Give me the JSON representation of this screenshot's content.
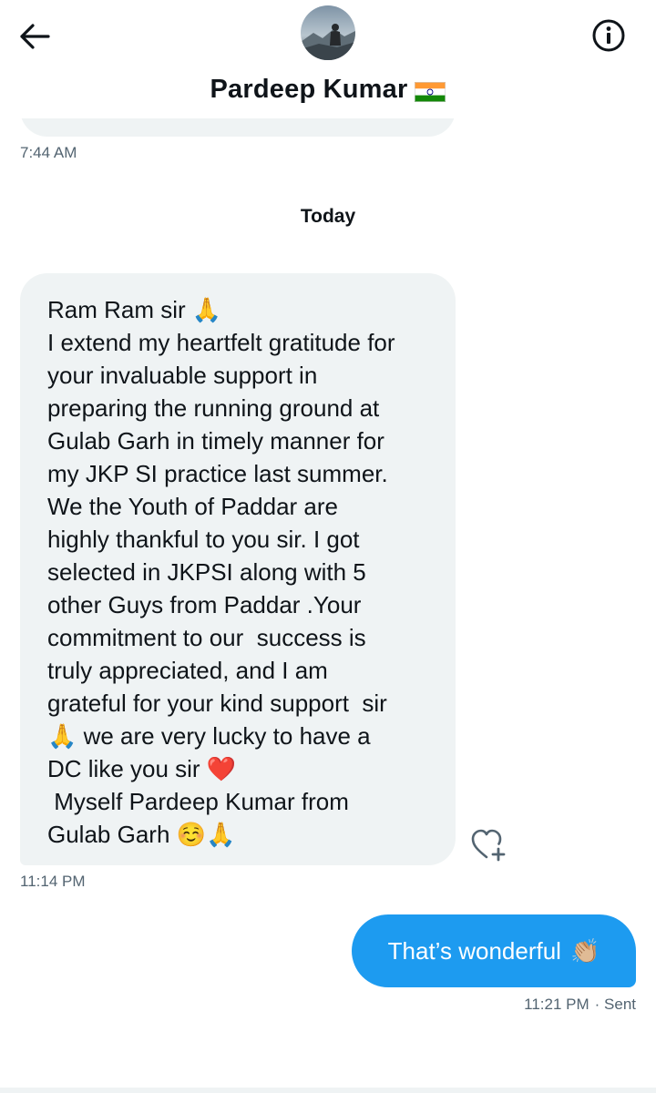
{
  "header": {
    "contact_name": "Pardeep Kumar",
    "flag_icon": "india-flag-icon",
    "back_icon": "arrow-left-icon",
    "info_icon": "info-icon"
  },
  "conversation": {
    "previous_timestamp": "7:44 AM",
    "day_divider": "Today",
    "received": {
      "text": "Ram Ram sir 🙏\nI extend my heartfelt gratitude for\nyour invaluable support in\npreparing the running ground at\nGulab Garh in timely manner for\nmy JKP SI practice last summer.\nWe the Youth of Paddar are\nhighly thankful to you sir. I got\nselected in JKPSI along with 5\nother Guys from Paddar .Your\ncommitment to our  success is\ntruly appreciated, and I am\ngrateful for your kind support  sir\n🙏 we are very lucky to have a\nDC like you sir ❤️\n Myself Pardeep Kumar from\nGulab Garh ☺️🙏",
      "timestamp": "11:14 PM",
      "react_icon": "heart-add-icon"
    },
    "sent": {
      "text": "That’s wonderful",
      "emoji": "👏🏼",
      "timestamp": "11:21 PM",
      "status": "· Sent"
    }
  },
  "colors": {
    "accent": "#1d9bf0",
    "bubble_received": "#eff3f4",
    "secondary_text": "#536471",
    "primary_text": "#0f1419"
  }
}
